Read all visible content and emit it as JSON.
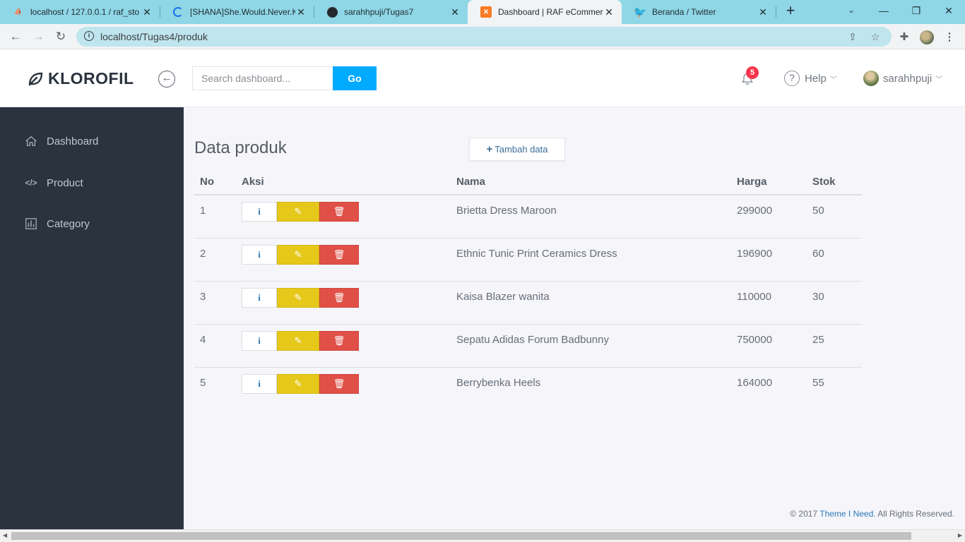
{
  "browser": {
    "tabs": [
      {
        "title": "localhost / 127.0.0.1 / raf_sto",
        "icon": "phpmyadmin-icon"
      },
      {
        "title": "[SHANA]She.Would.Never.Kn",
        "icon": "loading-spinner-icon"
      },
      {
        "title": "sarahhpuji/Tugas7",
        "icon": "github-icon"
      },
      {
        "title": "Dashboard | RAF eCommerce",
        "icon": "xampp-icon"
      },
      {
        "title": "Beranda / Twitter",
        "icon": "twitter-icon"
      }
    ],
    "url": "localhost/Tugas4/produk"
  },
  "header": {
    "brand": "KLOROFIL",
    "search_placeholder": "Search dashboard...",
    "go_label": "Go",
    "notif_count": "5",
    "help_label": "Help",
    "username": "sarahhpuji"
  },
  "sidebar": {
    "items": [
      {
        "label": "Dashboard",
        "icon": "home-icon"
      },
      {
        "label": "Product",
        "icon": "code-icon"
      },
      {
        "label": "Category",
        "icon": "bar-chart-icon"
      }
    ]
  },
  "main": {
    "title": "Data produk",
    "add_label": "Tambah data",
    "columns": [
      "No",
      "Aksi",
      "Nama",
      "Harga",
      "Stok"
    ],
    "rows": [
      {
        "no": "1",
        "nama": "Brietta Dress Maroon",
        "harga": "299000",
        "stok": "50"
      },
      {
        "no": "2",
        "nama": "Ethnic Tunic Print Ceramics Dress",
        "harga": "196900",
        "stok": "60"
      },
      {
        "no": "3",
        "nama": "Kaisa Blazer wanita",
        "harga": "110000",
        "stok": "30"
      },
      {
        "no": "4",
        "nama": "Sepatu Adidas Forum Badbunny",
        "harga": "750000",
        "stok": "25"
      },
      {
        "no": "5",
        "nama": "Berrybenka Heels",
        "harga": "164000",
        "stok": "55"
      }
    ]
  },
  "footer": {
    "prefix": "© 2017",
    "link": "Theme I Need",
    "suffix": ". All Rights Reserved."
  },
  "colors": {
    "sidebar_bg": "#2b333e",
    "go_button": "#00aaff",
    "edit_button": "#e5c81a",
    "delete_button": "#e05047",
    "badge": "#f9354c"
  }
}
